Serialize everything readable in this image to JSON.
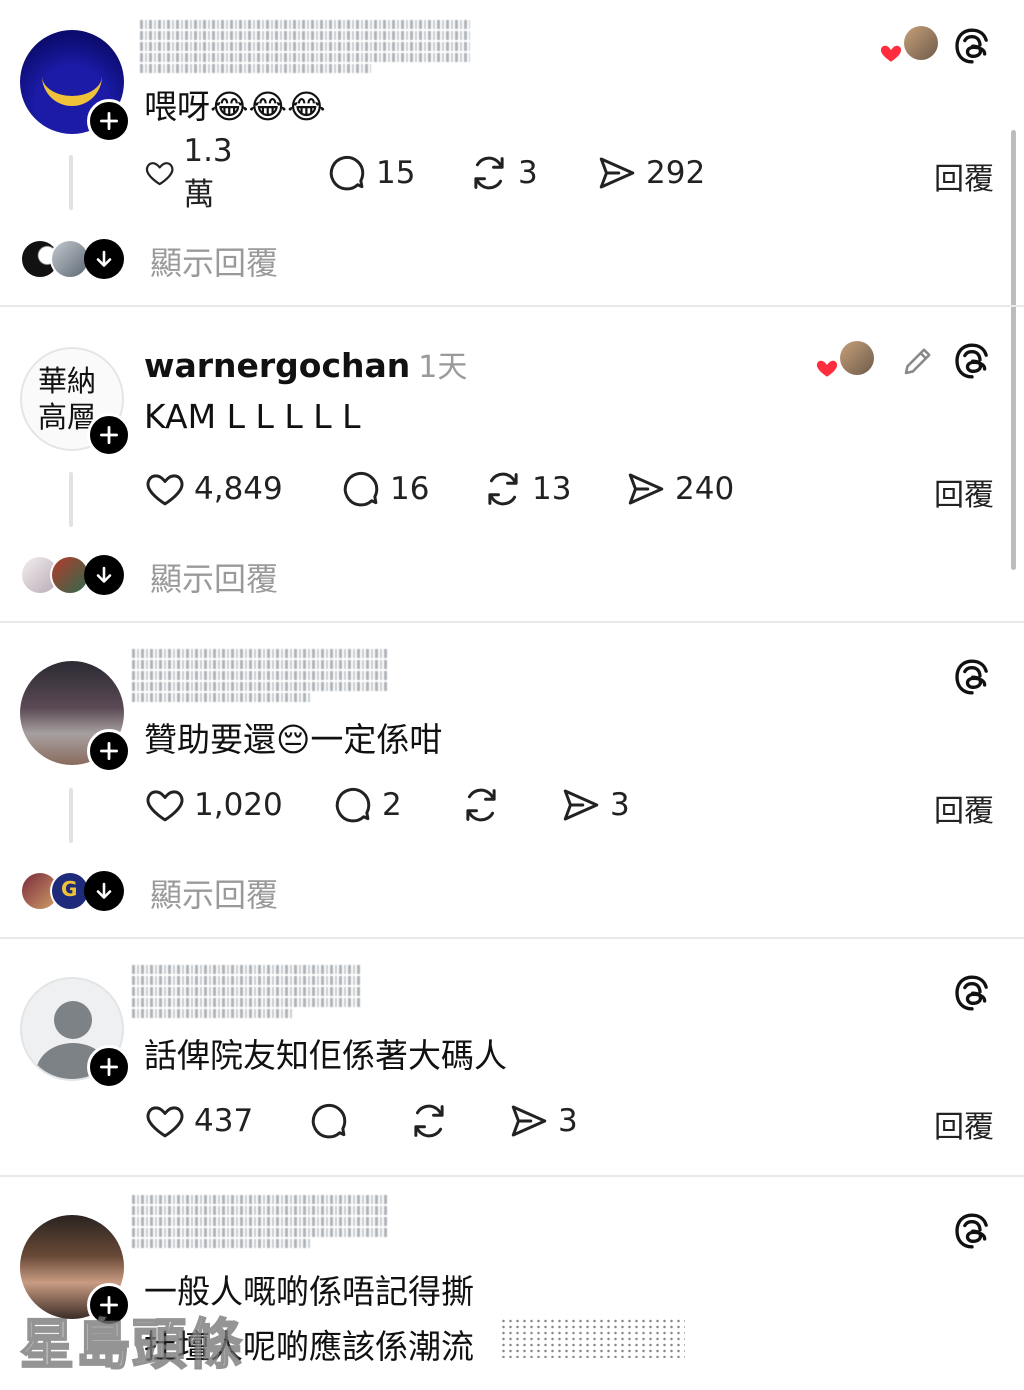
{
  "comments": [
    {
      "username": "",
      "time": "",
      "text": "喂呀😂😂😂",
      "likes": "1.3萬",
      "replies": "15",
      "reposts": "3",
      "shares": "292",
      "reply_label": "回覆",
      "show_replies_label": "顯示回覆"
    },
    {
      "username": "warnergochan",
      "time": "1天",
      "text": "KAM L L L L L",
      "likes": "4,849",
      "replies": "16",
      "reposts": "13",
      "shares": "240",
      "reply_label": "回覆",
      "show_replies_label": "顯示回覆",
      "avatar_text": [
        "華納",
        "高層"
      ]
    },
    {
      "username": "",
      "time": "",
      "text": "贊助要還😔一定係咁",
      "likes": "1,020",
      "replies": "2",
      "reposts": "",
      "shares": "3",
      "reply_label": "回覆",
      "show_replies_label": "顯示回覆"
    },
    {
      "username": "",
      "time": "",
      "text": "話俾院友知佢係著大碼人",
      "likes": "437",
      "replies": "",
      "reposts": "",
      "shares": "3",
      "reply_label": "回覆"
    },
    {
      "username": "",
      "time": "",
      "text_lines": [
        "一般人嘅啲係唔記得撕",
        "扗壇人呢啲應該係潮流"
      ]
    }
  ],
  "watermark": "星島頭條",
  "colors": {
    "accent_heart": "#ff2d3d",
    "muted_text": "#9a9a9a",
    "separator": "#e9e9e9"
  }
}
